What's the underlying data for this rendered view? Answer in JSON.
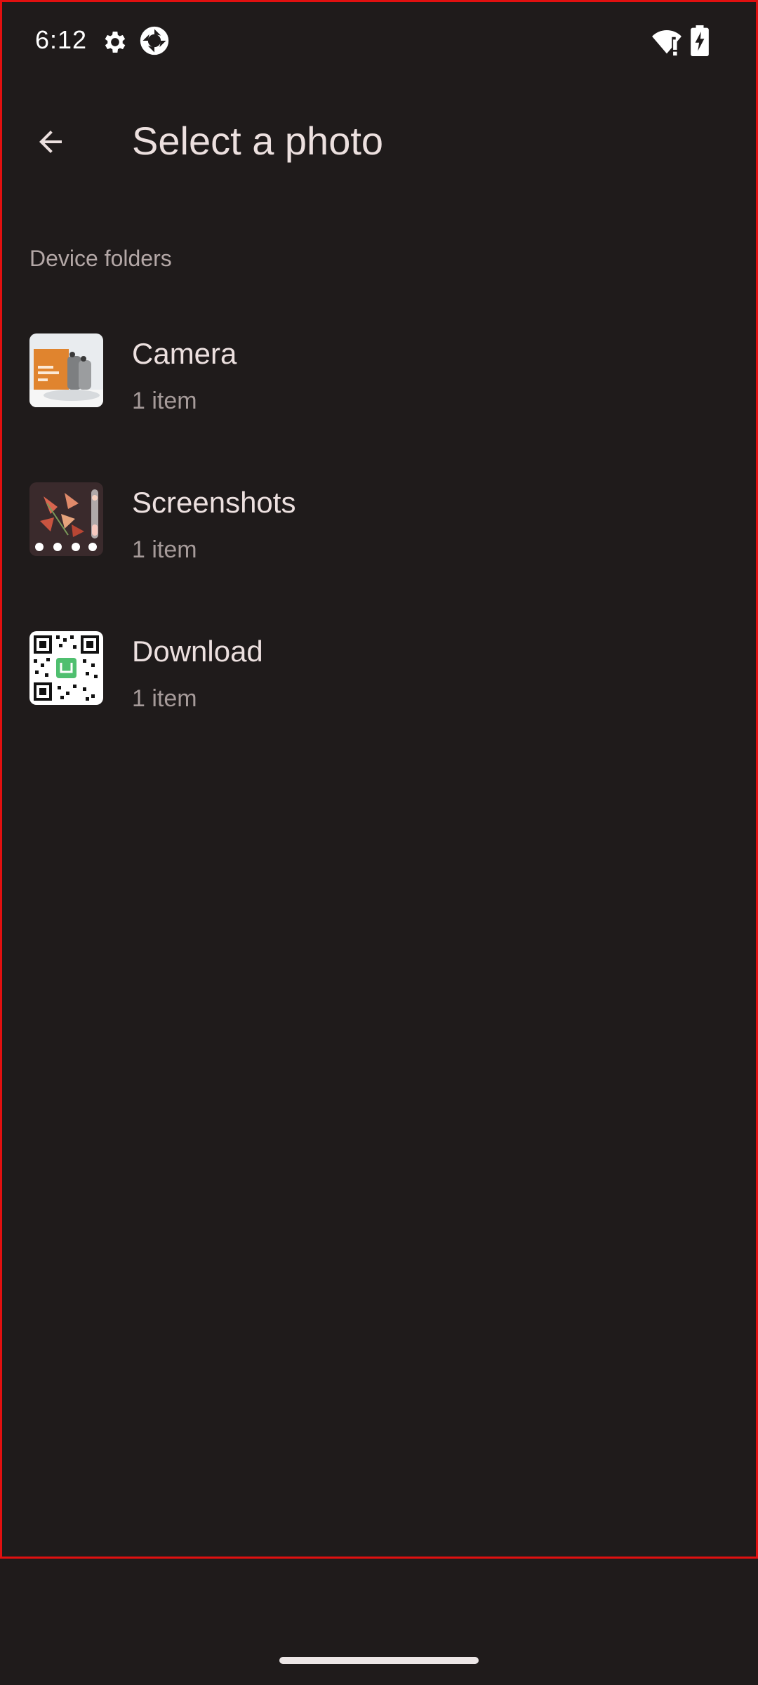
{
  "status_bar": {
    "time": "6:12",
    "icons": [
      "gear-icon",
      "app-shutter-icon",
      "wifi-alert-icon",
      "battery-charging-icon"
    ]
  },
  "app_bar": {
    "back_icon": "arrow-back-icon",
    "title": "Select a photo"
  },
  "section": {
    "header": "Device folders"
  },
  "folders": [
    {
      "name": "Camera",
      "count": "1 item",
      "thumb": "camera-thumbnail"
    },
    {
      "name": "Screenshots",
      "count": "1 item",
      "thumb": "screenshots-thumbnail"
    },
    {
      "name": "Download",
      "count": "1 item",
      "thumb": "qr-code-thumbnail"
    }
  ],
  "colors": {
    "background": "#1f1b1b",
    "text_primary": "#ece0df",
    "text_secondary": "#a69b9a",
    "accent_border": "#e01010"
  }
}
